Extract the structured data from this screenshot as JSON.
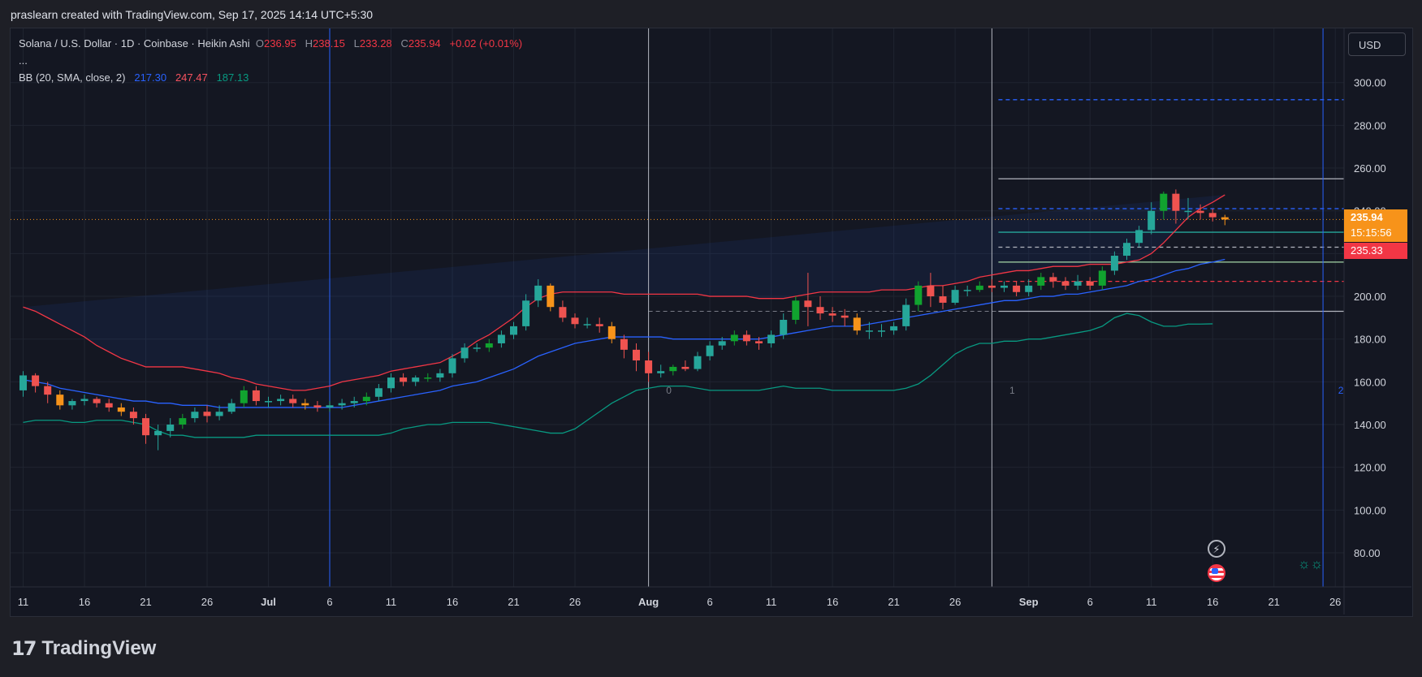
{
  "header": {
    "attribution": "praslearn created with TradingView.com, Sep 17, 2025 14:14 UTC+5:30"
  },
  "legend": {
    "symbol": "Solana / U.S. Dollar · 1D · Coinbase · Heikin Ashi",
    "o_label": "O",
    "o_value": "236.95",
    "h_label": "H",
    "h_value": "238.15",
    "l_label": "L",
    "l_value": "233.28",
    "c_label": "C",
    "c_value": "235.94",
    "change": "+0.02 (+0.01%)",
    "more": "...",
    "indicator": "BB (20, SMA, close, 2)",
    "bb_basis": "217.30",
    "bb_upper": "247.47",
    "bb_lower": "187.13"
  },
  "currency_button": "USD",
  "price_tags": {
    "last_price": "235.94",
    "countdown": "15:15:56",
    "second_price": "235.33"
  },
  "footer": {
    "logo_text": "TradingView"
  },
  "colors": {
    "up": "#26a69a",
    "down": "#ef5350",
    "up_alt": "#11a32f",
    "down_alt": "#f7931a",
    "bb_basis": "#2962ff",
    "bb_upper": "#f23645",
    "bb_lower": "#089981",
    "last_price": "#f7931a",
    "second_price": "#f23645"
  },
  "icons": [
    "lightning-icon",
    "us-flag-icon",
    "sun-icon",
    "tradingview-logo-icon"
  ],
  "chart_data": {
    "type": "candlestick",
    "style": "Heikin Ashi",
    "symbol": "Solana / U.S. Dollar",
    "interval": "1D",
    "exchange": "Coinbase",
    "ylim": [
      70,
      310
    ],
    "y_ticks": [
      "80.00",
      "100.00",
      "120.00",
      "140.00",
      "160.00",
      "180.00",
      "200.00",
      "220.00",
      "240.00",
      "260.00",
      "280.00",
      "300.00"
    ],
    "x_ticks": [
      "11",
      "16",
      "21",
      "26",
      "Jul",
      "6",
      "11",
      "16",
      "21",
      "26",
      "Aug",
      "6",
      "11",
      "16",
      "21",
      "26",
      "Sep",
      "6",
      "11",
      "16",
      "21",
      "26"
    ],
    "x_tick_dates": [
      "2025-06-11",
      "2025-06-16",
      "2025-06-21",
      "2025-06-26",
      "2025-07-01",
      "2025-07-06",
      "2025-07-11",
      "2025-07-16",
      "2025-07-21",
      "2025-07-26",
      "2025-08-01",
      "2025-08-06",
      "2025-08-11",
      "2025-08-16",
      "2025-08-21",
      "2025-08-26",
      "2025-09-01",
      "2025-09-06",
      "2025-09-11",
      "2025-09-16",
      "2025-09-21",
      "2025-09-26"
    ],
    "dates": [
      "2025-06-11",
      "2025-06-12",
      "2025-06-13",
      "2025-06-14",
      "2025-06-15",
      "2025-06-16",
      "2025-06-17",
      "2025-06-18",
      "2025-06-19",
      "2025-06-20",
      "2025-06-21",
      "2025-06-22",
      "2025-06-23",
      "2025-06-24",
      "2025-06-25",
      "2025-06-26",
      "2025-06-27",
      "2025-06-28",
      "2025-06-29",
      "2025-06-30",
      "2025-07-01",
      "2025-07-02",
      "2025-07-03",
      "2025-07-04",
      "2025-07-05",
      "2025-07-06",
      "2025-07-07",
      "2025-07-08",
      "2025-07-09",
      "2025-07-10",
      "2025-07-11",
      "2025-07-12",
      "2025-07-13",
      "2025-07-14",
      "2025-07-15",
      "2025-07-16",
      "2025-07-17",
      "2025-07-18",
      "2025-07-19",
      "2025-07-20",
      "2025-07-21",
      "2025-07-22",
      "2025-07-23",
      "2025-07-24",
      "2025-07-25",
      "2025-07-26",
      "2025-07-27",
      "2025-07-28",
      "2025-07-29",
      "2025-07-30",
      "2025-07-31",
      "2025-08-01",
      "2025-08-02",
      "2025-08-03",
      "2025-08-04",
      "2025-08-05",
      "2025-08-06",
      "2025-08-07",
      "2025-08-08",
      "2025-08-09",
      "2025-08-10",
      "2025-08-11",
      "2025-08-12",
      "2025-08-13",
      "2025-08-14",
      "2025-08-15",
      "2025-08-16",
      "2025-08-17",
      "2025-08-18",
      "2025-08-19",
      "2025-08-20",
      "2025-08-21",
      "2025-08-22",
      "2025-08-23",
      "2025-08-24",
      "2025-08-25",
      "2025-08-26",
      "2025-08-27",
      "2025-08-28",
      "2025-08-29",
      "2025-08-30",
      "2025-08-31",
      "2025-09-01",
      "2025-09-02",
      "2025-09-03",
      "2025-09-04",
      "2025-09-05",
      "2025-09-06",
      "2025-09-07",
      "2025-09-08",
      "2025-09-09",
      "2025-09-10",
      "2025-09-11",
      "2025-09-12",
      "2025-09-13",
      "2025-09-14",
      "2025-09-15",
      "2025-09-16",
      "2025-09-17"
    ],
    "open": [
      156,
      163,
      158,
      154,
      149,
      151,
      152,
      150,
      148,
      146,
      143,
      135,
      137,
      140,
      143,
      146,
      144,
      146,
      150,
      156,
      151,
      151,
      152,
      150,
      149,
      148,
      149,
      150,
      151,
      153,
      157,
      162,
      160,
      162,
      162,
      164,
      171,
      176,
      176,
      178,
      182,
      186,
      198,
      205,
      195,
      190,
      187,
      187,
      186,
      180,
      175,
      170,
      164,
      165,
      167,
      166,
      172,
      177,
      179,
      182,
      179,
      178,
      182,
      189,
      198,
      195,
      192,
      191,
      190,
      184,
      184,
      184,
      186,
      196,
      205,
      200,
      197,
      203,
      203,
      205,
      204,
      205,
      202,
      205,
      209,
      207,
      205,
      207,
      205,
      212,
      219,
      225,
      231,
      240,
      248,
      240,
      240,
      239,
      237
    ],
    "close": [
      163,
      158,
      154,
      149,
      151,
      152,
      150,
      148,
      146,
      143,
      135,
      137,
      140,
      143,
      146,
      144,
      146,
      150,
      156,
      151,
      151,
      152,
      150,
      149,
      148,
      149,
      150,
      151,
      153,
      157,
      162,
      160,
      162,
      162,
      164,
      171,
      176,
      176,
      178,
      182,
      186,
      198,
      205,
      195,
      190,
      187,
      187,
      186,
      180,
      175,
      170,
      164,
      165,
      167,
      166,
      172,
      177,
      179,
      182,
      179,
      178,
      182,
      189,
      198,
      195,
      192,
      191,
      190,
      184,
      184,
      184,
      186,
      196,
      205,
      200,
      197,
      203,
      203,
      205,
      204,
      205,
      202,
      205,
      209,
      207,
      205,
      207,
      205,
      212,
      219,
      225,
      231,
      240,
      248,
      240,
      240,
      239,
      237,
      235.94
    ],
    "high": [
      165,
      164,
      160,
      156,
      152,
      154,
      153,
      152,
      150,
      148,
      145,
      140,
      143,
      145,
      148,
      149,
      149,
      152,
      158,
      158,
      153,
      154,
      154,
      152,
      151,
      151,
      152,
      153,
      155,
      159,
      164,
      164,
      163,
      164,
      166,
      173,
      178,
      178,
      180,
      184,
      188,
      201,
      208,
      206,
      198,
      192,
      190,
      190,
      188,
      182,
      178,
      174,
      168,
      168,
      170,
      174,
      179,
      181,
      184,
      184,
      181,
      184,
      192,
      200,
      211,
      200,
      195,
      194,
      192,
      188,
      187,
      188,
      199,
      207,
      211,
      205,
      205,
      205,
      207,
      208,
      207,
      207,
      208,
      211,
      211,
      209,
      210,
      209,
      214,
      221,
      227,
      233,
      244,
      249,
      250,
      246,
      243,
      241,
      238.15
    ],
    "low": [
      153,
      155,
      150,
      147,
      147,
      149,
      148,
      146,
      144,
      140,
      131,
      128,
      134,
      138,
      141,
      141,
      142,
      145,
      148,
      149,
      148,
      149,
      148,
      147,
      146,
      146,
      147,
      148,
      149,
      151,
      155,
      158,
      158,
      160,
      160,
      162,
      169,
      174,
      174,
      176,
      180,
      184,
      195,
      193,
      188,
      185,
      185,
      183,
      178,
      171,
      165,
      160,
      162,
      163,
      165,
      165,
      170,
      175,
      177,
      177,
      175,
      176,
      180,
      187,
      186,
      189,
      188,
      186,
      182,
      180,
      181,
      182,
      184,
      193,
      195,
      194,
      196,
      200,
      202,
      202,
      202,
      200,
      200,
      203,
      204,
      203,
      203,
      203,
      203,
      210,
      217,
      223,
      229,
      236,
      234,
      236,
      236,
      235,
      233.28
    ],
    "bb_upper": [
      195,
      193,
      190,
      187,
      184,
      181,
      177,
      174,
      171,
      169,
      167,
      167,
      167,
      167,
      166,
      165,
      164,
      162,
      161,
      159,
      158,
      157,
      156,
      156,
      157,
      158,
      160,
      161,
      162,
      163,
      165,
      166,
      167,
      168,
      169,
      172,
      175,
      179,
      182,
      186,
      190,
      195,
      199,
      201,
      202,
      202,
      202,
      202,
      202,
      201,
      201,
      201,
      201,
      201,
      201,
      201,
      200,
      200,
      200,
      200,
      199,
      199,
      199,
      200,
      201,
      202,
      202,
      202,
      202,
      202,
      203,
      203,
      203,
      204,
      205,
      205,
      206,
      207,
      209,
      210,
      211,
      212,
      212,
      213,
      214,
      214,
      214,
      215,
      215,
      215,
      216,
      217,
      220,
      225,
      231,
      237,
      241,
      244,
      247.47
    ],
    "bb_basis": [
      161,
      160,
      159,
      157,
      156,
      155,
      154,
      153,
      152,
      151,
      151,
      150,
      150,
      149,
      149,
      149,
      148,
      148,
      148,
      148,
      148,
      148,
      148,
      148,
      148,
      148,
      148,
      149,
      150,
      151,
      152,
      153,
      154,
      155,
      156,
      158,
      159,
      160,
      162,
      164,
      166,
      169,
      172,
      174,
      176,
      178,
      179,
      180,
      181,
      181,
      181,
      181,
      181,
      180,
      180,
      180,
      180,
      180,
      180,
      180,
      180,
      181,
      182,
      183,
      184,
      185,
      186,
      186,
      186,
      187,
      188,
      189,
      190,
      191,
      192,
      193,
      194,
      195,
      196,
      197,
      198,
      198,
      199,
      200,
      200,
      201,
      201,
      202,
      203,
      204,
      205,
      207,
      208,
      210,
      212,
      213,
      215,
      216,
      217.3
    ],
    "bb_lower": [
      141,
      142,
      142,
      142,
      141,
      141,
      142,
      142,
      142,
      141,
      140,
      137,
      135,
      135,
      134,
      134,
      134,
      134,
      134,
      135,
      135,
      135,
      135,
      135,
      135,
      135,
      135,
      135,
      135,
      135,
      136,
      138,
      139,
      140,
      140,
      141,
      141,
      141,
      141,
      140,
      139,
      138,
      137,
      136,
      136,
      138,
      142,
      146,
      150,
      153,
      156,
      157,
      158,
      158,
      158,
      157,
      156,
      156,
      156,
      156,
      156,
      157,
      158,
      157,
      157,
      157,
      156,
      156,
      156,
      156,
      156,
      156,
      157,
      159,
      163,
      168,
      173,
      176,
      178,
      178,
      179,
      179,
      180,
      180,
      181,
      182,
      183,
      184,
      186,
      190,
      192,
      191,
      188,
      186,
      186,
      187,
      187,
      187.13
    ],
    "horizontal_levels": [
      {
        "price": 292,
        "style": "dashed",
        "color": "#2962ff"
      },
      {
        "price": 255,
        "style": "solid",
        "color": "#b2b5be"
      },
      {
        "price": 241,
        "style": "dashed",
        "color": "#2962ff"
      },
      {
        "price": 230,
        "style": "solid",
        "color": "#26a69a"
      },
      {
        "price": 223,
        "style": "dashed",
        "color": "#b2b5be"
      },
      {
        "price": 216,
        "style": "solid",
        "color": "#a5d6a7"
      },
      {
        "price": 207,
        "style": "dashed",
        "color": "#f23645"
      },
      {
        "price": 193,
        "style": "solid",
        "color": "#b2b5be"
      }
    ],
    "vertical_markers": [
      {
        "date": "2025-07-06",
        "color": "#2962ff",
        "label": ""
      },
      {
        "date": "2025-08-01",
        "color": "#b2b5be",
        "label": "0"
      },
      {
        "date": "2025-08-29",
        "color": "#b2b5be",
        "label": "1"
      },
      {
        "date": "2025-09-25",
        "color": "#2962ff",
        "label": "2"
      }
    ],
    "last_price": 235.94,
    "grid": true
  }
}
